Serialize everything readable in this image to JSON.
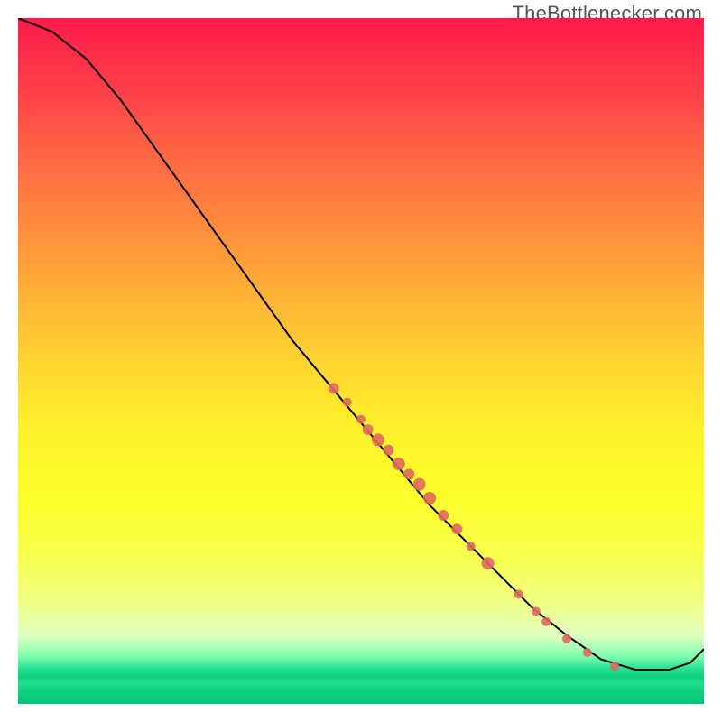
{
  "watermark": "TheBottlenecker.com",
  "chart_data": {
    "type": "line",
    "title": "",
    "xlabel": "",
    "ylabel": "",
    "xlim": [
      0,
      100
    ],
    "ylim": [
      0,
      100
    ],
    "curve": [
      {
        "x": 0,
        "y": 100
      },
      {
        "x": 5,
        "y": 98
      },
      {
        "x": 10,
        "y": 94
      },
      {
        "x": 15,
        "y": 88
      },
      {
        "x": 20,
        "y": 81
      },
      {
        "x": 25,
        "y": 74
      },
      {
        "x": 30,
        "y": 67
      },
      {
        "x": 35,
        "y": 60
      },
      {
        "x": 40,
        "y": 53
      },
      {
        "x": 45,
        "y": 47
      },
      {
        "x": 50,
        "y": 41
      },
      {
        "x": 55,
        "y": 35
      },
      {
        "x": 60,
        "y": 29
      },
      {
        "x": 65,
        "y": 24
      },
      {
        "x": 70,
        "y": 19
      },
      {
        "x": 75,
        "y": 14
      },
      {
        "x": 80,
        "y": 10
      },
      {
        "x": 85,
        "y": 6.5
      },
      {
        "x": 90,
        "y": 5
      },
      {
        "x": 95,
        "y": 5
      },
      {
        "x": 98,
        "y": 6
      },
      {
        "x": 100,
        "y": 8
      }
    ],
    "scatter": [
      {
        "x": 46,
        "y": 46,
        "r": 6
      },
      {
        "x": 48,
        "y": 44,
        "r": 5
      },
      {
        "x": 50,
        "y": 41.5,
        "r": 5
      },
      {
        "x": 51,
        "y": 40,
        "r": 6
      },
      {
        "x": 52.5,
        "y": 38.5,
        "r": 7
      },
      {
        "x": 54,
        "y": 37,
        "r": 6
      },
      {
        "x": 55.5,
        "y": 35,
        "r": 7
      },
      {
        "x": 57,
        "y": 33.5,
        "r": 6
      },
      {
        "x": 58.5,
        "y": 32,
        "r": 7
      },
      {
        "x": 60,
        "y": 30,
        "r": 7
      },
      {
        "x": 62,
        "y": 27.5,
        "r": 6
      },
      {
        "x": 64,
        "y": 25.5,
        "r": 6
      },
      {
        "x": 66,
        "y": 23,
        "r": 5
      },
      {
        "x": 68.5,
        "y": 20.5,
        "r": 7
      },
      {
        "x": 73,
        "y": 16,
        "r": 5
      },
      {
        "x": 75.5,
        "y": 13.5,
        "r": 5
      },
      {
        "x": 77,
        "y": 12,
        "r": 5
      },
      {
        "x": 80,
        "y": 9.5,
        "r": 5
      },
      {
        "x": 83,
        "y": 7.5,
        "r": 5
      },
      {
        "x": 87,
        "y": 5.5,
        "r": 5
      }
    ],
    "curve_color": "#000000",
    "point_color": "#e0695e"
  }
}
